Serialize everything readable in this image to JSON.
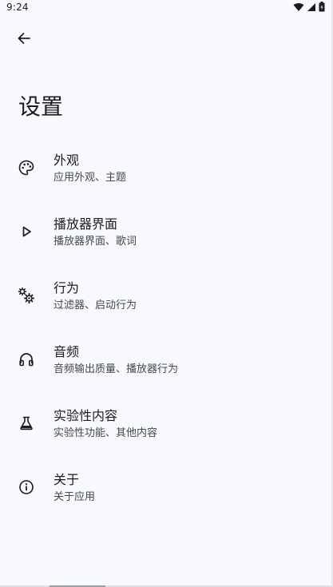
{
  "status_bar": {
    "time": "9:24",
    "icons": [
      "wifi-icon",
      "cellular-signal-icon",
      "battery-icon"
    ]
  },
  "top_bar": {
    "back_icon": "arrow-left-icon"
  },
  "page": {
    "title": "设置"
  },
  "settings": {
    "items": [
      {
        "id": "appearance",
        "icon": "palette-icon",
        "title": "外观",
        "subtitle": "应用外观、主题"
      },
      {
        "id": "player",
        "icon": "play-icon",
        "title": "播放器界面",
        "subtitle": "播放器界面、歌词"
      },
      {
        "id": "behavior",
        "icon": "gears-icon",
        "title": "行为",
        "subtitle": "过滤器、启动行为"
      },
      {
        "id": "audio",
        "icon": "headphones-icon",
        "title": "音频",
        "subtitle": "音频输出质量、播放器行为"
      },
      {
        "id": "experimental",
        "icon": "flask-icon",
        "title": "实验性内容",
        "subtitle": "实验性功能、其他内容"
      },
      {
        "id": "about",
        "icon": "info-icon",
        "title": "关于",
        "subtitle": "关于应用"
      }
    ]
  },
  "colors": {
    "background": "#f7f9ff",
    "text_primary": "#1b1c20",
    "text_secondary": "#44474f"
  }
}
